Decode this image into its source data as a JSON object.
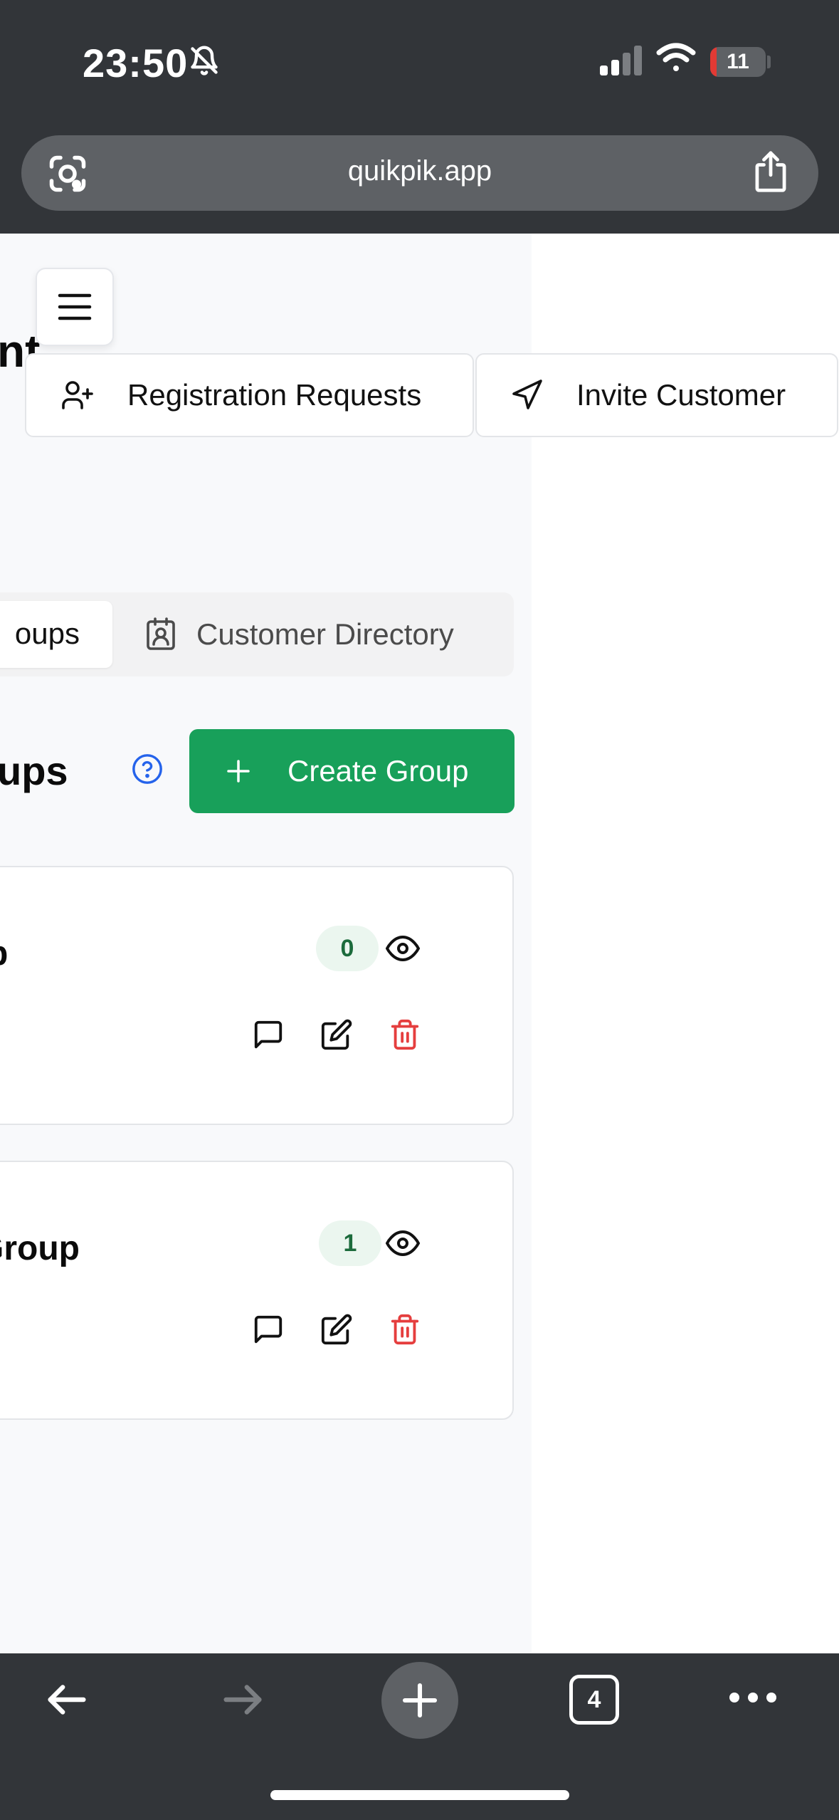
{
  "status_bar": {
    "time": "23:50",
    "battery": "11",
    "battery_level": 0.11,
    "icons": [
      "bell-slash-icon",
      "cellular-signal-icon",
      "wifi-icon",
      "battery-icon"
    ]
  },
  "browser": {
    "url": "quikpik.app",
    "icons": [
      "camera-lens-icon",
      "share-icon"
    ]
  },
  "header": {
    "title_fragment": "nt",
    "menu_icon": "hamburger-menu-icon",
    "registration_requests_label": "Registration Requests",
    "invite_customer_label": "Invite Customer"
  },
  "tabs": {
    "groups_label": "oups",
    "directory_label": "Customer Directory"
  },
  "groups_section": {
    "title": "ups",
    "create_label": "Create Group"
  },
  "groups": [
    {
      "name": "p",
      "count": "0"
    },
    {
      "name": "Group",
      "count": "1"
    }
  ],
  "toolbar": {
    "tab_count": "4",
    "icons": [
      "back-arrow-icon",
      "forward-arrow-icon",
      "new-tab-plus-icon",
      "tabs-icon",
      "more-icon"
    ]
  },
  "colors": {
    "chrome": "#323539",
    "primary_green": "#18a05a",
    "danger_red": "#e53e3e",
    "help_blue": "#2563eb"
  }
}
